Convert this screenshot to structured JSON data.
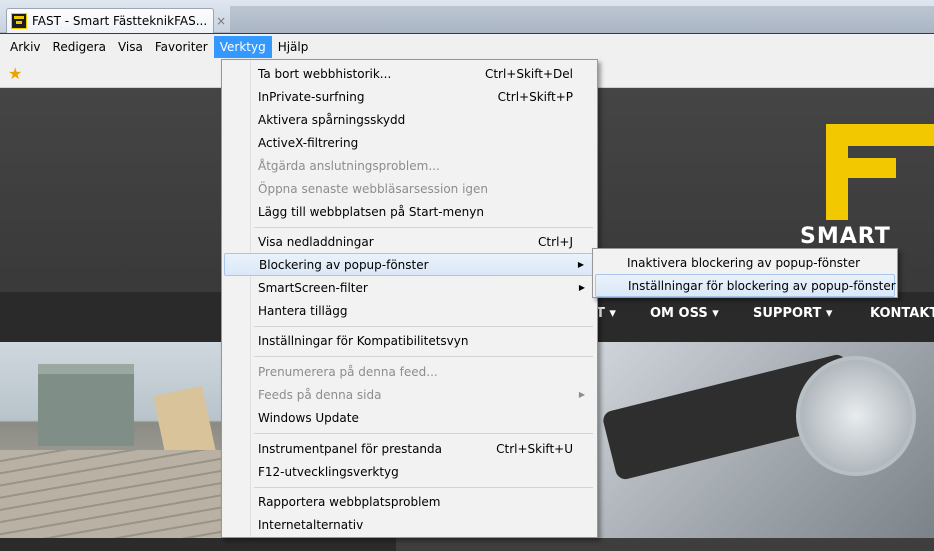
{
  "tab": {
    "title": "FAST - Smart FästteknikFAS...",
    "close": "×"
  },
  "menubar": [
    "Arkiv",
    "Redigera",
    "Visa",
    "Favoriter",
    "Verktyg",
    "Hjälp"
  ],
  "favorites": {
    "icon": "star-add-icon"
  },
  "site": {
    "logo_text": "SMART",
    "nav": [
      "T ▾",
      "OM OSS ▾",
      "SUPPORT ▾",
      "KONTAKT"
    ],
    "colors": {
      "brand_yellow": "#f2c800"
    }
  },
  "menu": {
    "items": [
      {
        "label": "Ta bort webbhistorik...",
        "shortcut": "Ctrl+Skift+Del"
      },
      {
        "label": "InPrivate-surfning",
        "shortcut": "Ctrl+Skift+P"
      },
      {
        "label": "Aktivera spårningsskydd",
        "shortcut": ""
      },
      {
        "label": "ActiveX-filtrering",
        "shortcut": ""
      },
      {
        "label": "Åtgärda anslutningsproblem...",
        "shortcut": "",
        "disabled": true
      },
      {
        "label": "Öppna senaste webbläsarsession igen",
        "shortcut": "",
        "disabled": true
      },
      {
        "label": "Lägg till webbplatsen på Start-menyn",
        "shortcut": ""
      },
      {
        "label": "Visa nedladdningar",
        "shortcut": "Ctrl+J"
      },
      {
        "label": "Blockering av popup-fönster",
        "shortcut": "",
        "submenu": true
      },
      {
        "label": "SmartScreen-filter",
        "shortcut": "",
        "submenu": true
      },
      {
        "label": "Hantera tillägg",
        "shortcut": ""
      },
      {
        "label": "Inställningar för Kompatibilitetsvyn",
        "shortcut": ""
      },
      {
        "label": "Prenumerera på denna feed...",
        "shortcut": "",
        "disabled": true
      },
      {
        "label": "Feeds på denna sida",
        "shortcut": "",
        "disabled": true,
        "submenu": true
      },
      {
        "label": "Windows Update",
        "shortcut": ""
      },
      {
        "label": "Instrumentpanel för prestanda",
        "shortcut": "Ctrl+Skift+U"
      },
      {
        "label": "F12-utvecklingsverktyg",
        "shortcut": ""
      },
      {
        "label": "Rapportera webbplatsproblem",
        "shortcut": ""
      },
      {
        "label": "Internetalternativ",
        "shortcut": ""
      }
    ],
    "arrow": "▶"
  },
  "submenu": {
    "items": [
      "Inaktivera blockering av popup-fönster",
      "Inställningar för blockering av popup-fönster"
    ]
  }
}
